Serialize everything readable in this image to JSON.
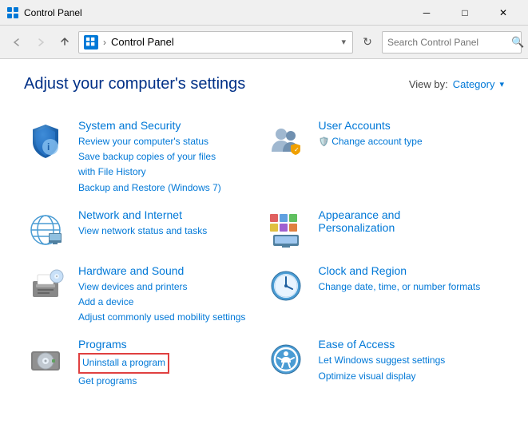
{
  "titlebar": {
    "title": "Control Panel",
    "min_label": "─",
    "max_label": "□",
    "close_label": "✕"
  },
  "navbar": {
    "back_label": "‹",
    "forward_label": "›",
    "up_label": "↑",
    "address_icon": "⊞",
    "address_text": "Control Panel",
    "dropdown_label": "▾",
    "refresh_label": "↻",
    "search_placeholder": "Search Control Panel",
    "search_icon": "🔍"
  },
  "content": {
    "page_title": "Adjust your computer's settings",
    "viewby_label": "View by:",
    "viewby_value": "Category",
    "viewby_arrow": "▾",
    "categories": [
      {
        "id": "system-security",
        "title": "System and Security",
        "links": [
          "Review your computer's status",
          "Save backup copies of your files with File History",
          "Backup and Restore (Windows 7)"
        ]
      },
      {
        "id": "user-accounts",
        "title": "User Accounts",
        "links": [
          "Change account type"
        ],
        "link_icons": [
          "shield-small"
        ]
      },
      {
        "id": "network-internet",
        "title": "Network and Internet",
        "links": [
          "View network status and tasks"
        ]
      },
      {
        "id": "appearance",
        "title": "Appearance and Personalization",
        "links": []
      },
      {
        "id": "hardware-sound",
        "title": "Hardware and Sound",
        "links": [
          "View devices and printers",
          "Add a device",
          "Adjust commonly used mobility settings"
        ]
      },
      {
        "id": "clock-region",
        "title": "Clock and Region",
        "links": [
          "Change date, time, or number formats"
        ]
      },
      {
        "id": "programs",
        "title": "Programs",
        "links": [
          "Uninstall a program",
          "Get programs"
        ],
        "highlighted_link_index": 0
      },
      {
        "id": "ease-access",
        "title": "Ease of Access",
        "links": [
          "Let Windows suggest settings",
          "Optimize visual display"
        ]
      }
    ]
  }
}
